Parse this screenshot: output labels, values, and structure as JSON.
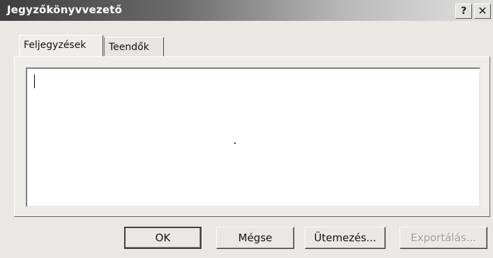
{
  "window": {
    "title": "Jegyzőkönyvvezető",
    "help_label": "?",
    "close_label": "✕"
  },
  "tabs": [
    {
      "label": "Feljegyzések",
      "active": true
    },
    {
      "label": "Teendők",
      "active": false
    }
  ],
  "notes": {
    "value": ""
  },
  "buttons": {
    "ok": "OK",
    "cancel": "Mégse",
    "schedule": "Ütemezés...",
    "export": "Exportálás..."
  },
  "colors": {
    "titlebar_start": "#3e3e3e",
    "titlebar_end": "#e2e2e2",
    "face": "#e9e8e4",
    "disabled_text": "#9a9a9a"
  }
}
